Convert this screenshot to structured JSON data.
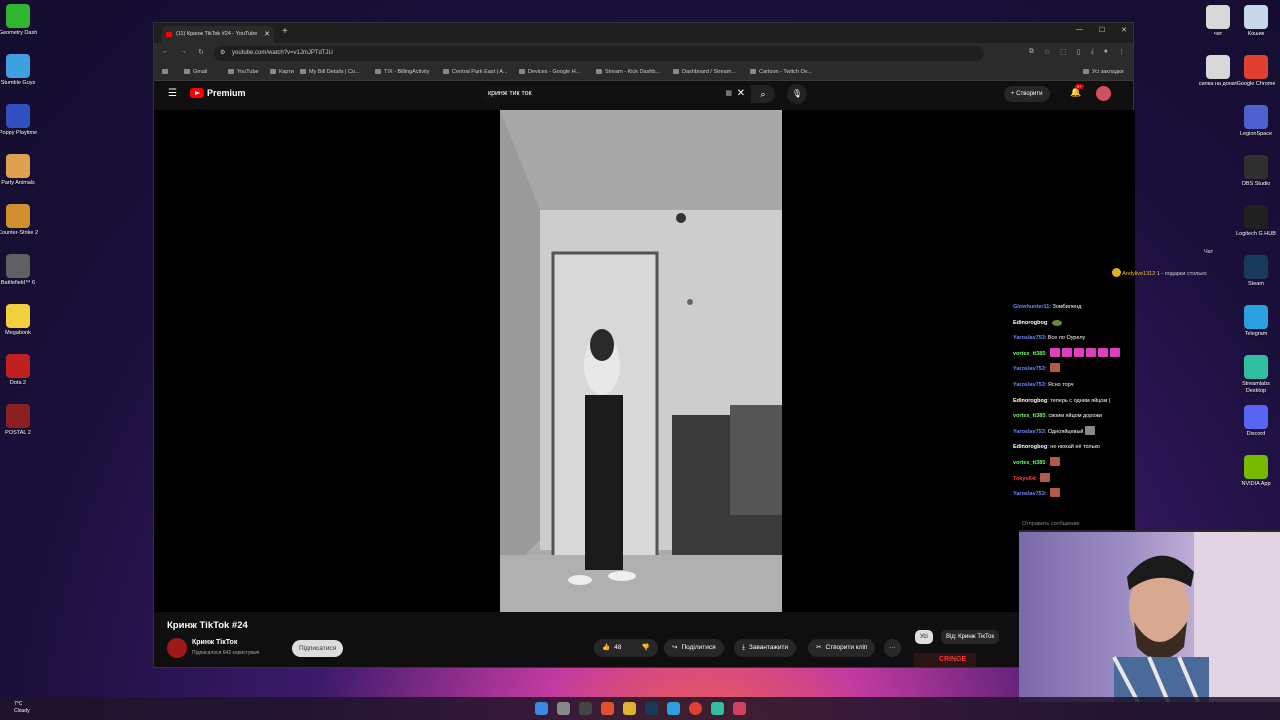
{
  "desktop_left": [
    {
      "label": "Geometry Dash",
      "color": "#2fb52f"
    },
    {
      "label": "Stumble Guys",
      "color": "#3fa0e0"
    },
    {
      "label": "Poppy Playtime",
      "color": "#3050c0"
    },
    {
      "label": "Party Animals",
      "color": "#e0a050"
    },
    {
      "label": "Counter-Strike 2",
      "color": "#d09030"
    },
    {
      "label": "Battlefield™ 6",
      "color": "#606060"
    },
    {
      "label": "Megabonk",
      "color": "#f0d040"
    },
    {
      "label": "Dota 2",
      "color": "#c02020"
    },
    {
      "label": "POSTAL 2",
      "color": "#8a2020"
    }
  ],
  "desktop_right": [
    {
      "label": "чат",
      "color": "#d8d8d8"
    },
    {
      "label": "Кошик",
      "color": "#c8d8e8"
    },
    {
      "label": "силка на донат",
      "color": "#d8d8d8"
    },
    {
      "label": "Google Chrome",
      "color": "#e04030"
    },
    {
      "label": "LegionSpace",
      "color": "#5060d0"
    },
    {
      "label": "OBS Studio",
      "color": "#303030"
    },
    {
      "label": "Logitech G HUB",
      "color": "#202020"
    },
    {
      "label": "Steam",
      "color": "#1a3a5a"
    },
    {
      "label": "Telegram",
      "color": "#2aa0e0"
    },
    {
      "label": "Streamlabs Desktop",
      "color": "#30c0a0"
    },
    {
      "label": "Discord",
      "color": "#5865f2"
    },
    {
      "label": "NVIDIA App",
      "color": "#76b900"
    }
  ],
  "browser": {
    "tab_title": "(11) Кринж TikTok #24 - YouTube",
    "url": "youtube.com/watch?v=v1JmJPTdTJU",
    "bookmarks": [
      "Gmail",
      "YouTube",
      "Карти",
      "My Bill Details | Co...",
      "TIX - BillingActivity",
      "Central Park East | A...",
      "Devices - Google H...",
      "Stream - Kick Dashb...",
      "Dashboard / Stream...",
      "Cartoon - Twitch Ov..."
    ],
    "bookmarks_all": "Усі закладки"
  },
  "youtube": {
    "logo_text": "Premium",
    "search_query": "кринж тик ток",
    "create_label": "Створити",
    "notif_count": "9+",
    "video_title": "Кринж TikTok #24",
    "channel_name": "Кринж ТікТок",
    "channel_subs": "Підписалося 642 користувачі",
    "subscribe_label": "Підписатися",
    "like_count": "48",
    "share_label": "Поділитися",
    "download_label": "Завантажити",
    "clip_label": "Створити кліп",
    "more_label": "···",
    "chip_all": "Усі",
    "chip_from": "Від: Кринж ТікТок",
    "thumb_text": "CRINGE"
  },
  "chat": {
    "label": "Чат",
    "gift_user": "Andylive1312",
    "gift_text": "1 - подарки столько",
    "input_placeholder": "Отправить сообщение",
    "messages": [
      {
        "user": "Glowhunter11",
        "color": "#6a8aff",
        "text": "Зомбиленд",
        "emote": ""
      },
      {
        "user": "Edinorogbog",
        "color": "#ffffff",
        "text": "",
        "emote": "green"
      },
      {
        "user": "Yaroslav753",
        "color": "#6a8aff",
        "text": "Все по Оурелу",
        "emote": ""
      },
      {
        "user": "vortex_tt385",
        "color": "#6aff6a",
        "text": "",
        "emote": "pink"
      },
      {
        "user": "Yaroslav753",
        "color": "#6a8aff",
        "text": "",
        "emote": "brown"
      },
      {
        "user": "Yaroslav753",
        "color": "#6a8aff",
        "text": "Ясно торч",
        "emote": ""
      },
      {
        "user": "Edinorogbog",
        "color": "#ffffff",
        "text": "теперь с одним яйцом (",
        "emote": ""
      },
      {
        "user": "vortex_tt385",
        "color": "#6aff6a",
        "text": "своим яйцом дорожи",
        "emote": ""
      },
      {
        "user": "Yaroslav753",
        "color": "#6a8aff",
        "text": "Однояйцевый",
        "emote": "gray"
      },
      {
        "user": "Edinorogbog",
        "color": "#ffffff",
        "text": "не нюхай её только",
        "emote": ""
      },
      {
        "user": "vortex_tt385",
        "color": "#6aff6a",
        "text": "",
        "emote": "brown"
      },
      {
        "user": "Tokyo64",
        "color": "#ff4040",
        "text": "",
        "emote": "brown"
      },
      {
        "user": "Yaroslav753",
        "color": "#6a8aff",
        "text": "",
        "emote": "brown"
      }
    ]
  },
  "taskbar": {
    "weather_temp": "7°C",
    "weather_text": "Cloudy"
  }
}
